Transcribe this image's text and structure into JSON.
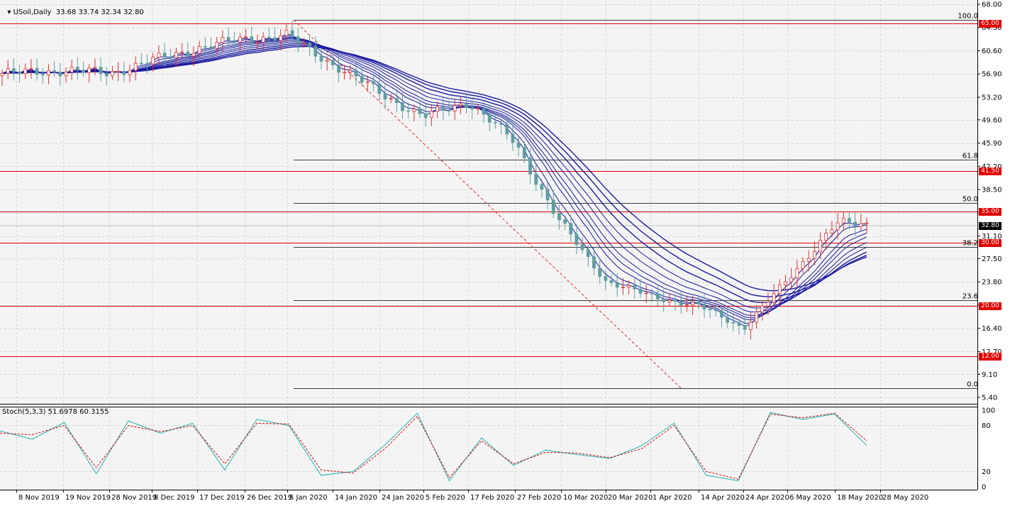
{
  "header": {
    "symbol_icon": "triangle-down-icon",
    "title": "USoil,Daily",
    "ohlc": "33.68 33.74 32.34 32.80"
  },
  "stoch_header": {
    "label": "Stoch(5,3,3) 51.6978 60.3155"
  },
  "price_axis": {
    "ticks": [
      "68.00",
      "64.30",
      "60.60",
      "56.90",
      "53.20",
      "49.60",
      "45.90",
      "42.20",
      "38.50",
      "34.80",
      "31.10",
      "27.50",
      "23.80",
      "20.10",
      "16.40",
      "12.70",
      "9.10",
      "5.40"
    ],
    "current_price": "32.80"
  },
  "stoch_axis": {
    "ticks": [
      "100",
      "80",
      "20",
      "0"
    ]
  },
  "date_axis": {
    "labels": [
      "8 Nov 2019",
      "19 Nov 2019",
      "28 Nov 2019",
      "8 Dec 2019",
      "17 Dec 2019",
      "26 Dec 2019",
      "5 Jan 2020",
      "14 Jan 2020",
      "24 Jan 2020",
      "5 Feb 2020",
      "17 Feb 2020",
      "27 Feb 2020",
      "10 Mar 2020",
      "20 Mar 2020",
      "1 Apr 2020",
      "14 Apr 2020",
      "24 Apr 2020",
      "6 May 2020",
      "18 May 2020",
      "28 May 2020"
    ]
  },
  "horizontal_levels": [
    {
      "label": "65.00",
      "price": 65.0
    },
    {
      "label": "41.50",
      "price": 41.5
    },
    {
      "label": "35.00",
      "price": 35.0
    },
    {
      "label": "30.00",
      "price": 30.0
    },
    {
      "label": "20.00",
      "price": 20.0
    },
    {
      "label": "12.00",
      "price": 12.0
    }
  ],
  "fibonacci": {
    "levels": [
      {
        "label": "100.0",
        "price": 65.5
      },
      {
        "label": "61.8",
        "price": 43.3
      },
      {
        "label": "50.0",
        "price": 36.4
      },
      {
        "label": "38.2",
        "price": 29.3
      },
      {
        "label": "23.6",
        "price": 20.9
      },
      {
        "label": "0.0",
        "price": 6.9
      }
    ]
  },
  "colors": {
    "background": "#f4f4f4",
    "grid": "#c8c8c8",
    "bull": "#e03030",
    "bear": "#5f9ea0",
    "ma": "#1a1aa0",
    "levels": "#e00000",
    "stoch_main": "#20b2b2",
    "stoch_signal": "#e00000"
  },
  "chart_data": [
    {
      "type": "candlestick",
      "title": "USoil,Daily",
      "x": [
        "8 Nov 2019",
        "19 Nov 2019",
        "28 Nov 2019",
        "8 Dec 2019",
        "17 Dec 2019",
        "26 Dec 2019",
        "5 Jan 2020",
        "14 Jan 2020",
        "24 Jan 2020",
        "5 Feb 2020",
        "17 Feb 2020",
        "27 Feb 2020",
        "10 Mar 2020",
        "20 Mar 2020",
        "1 Apr 2020",
        "14 Apr 2020",
        "24 Apr 2020",
        "6 May 2020",
        "18 May 2020",
        "28 May 2020"
      ],
      "close": [
        57.0,
        57.5,
        57.0,
        59.0,
        61.0,
        62.5,
        63.0,
        58.5,
        54.0,
        50.0,
        52.5,
        46.0,
        33.0,
        24.0,
        21.5,
        20.0,
        16.5,
        24.0,
        33.0,
        32.8
      ],
      "ylim": [
        5.4,
        68.0
      ],
      "series": [
        {
          "name": "Moving averages (ribbon)"
        }
      ]
    },
    {
      "type": "line",
      "title": "Stoch(5,3,3) 51.6978 60.3155",
      "series": [
        {
          "name": "main",
          "values": [
            73,
            62,
            84,
            17,
            86,
            70,
            83,
            22,
            88,
            80,
            15,
            20,
            55,
            96,
            8,
            64,
            28,
            48,
            42,
            37,
            54,
            83,
            15,
            8,
            97,
            88,
            95,
            54
          ]
        },
        {
          "name": "signal",
          "values": [
            70,
            68,
            80,
            25,
            80,
            72,
            80,
            30,
            83,
            82,
            22,
            18,
            50,
            92,
            12,
            60,
            30,
            45,
            44,
            38,
            50,
            80,
            20,
            10,
            95,
            90,
            96,
            60
          ]
        }
      ],
      "ylim": [
        0,
        100
      ]
    }
  ]
}
